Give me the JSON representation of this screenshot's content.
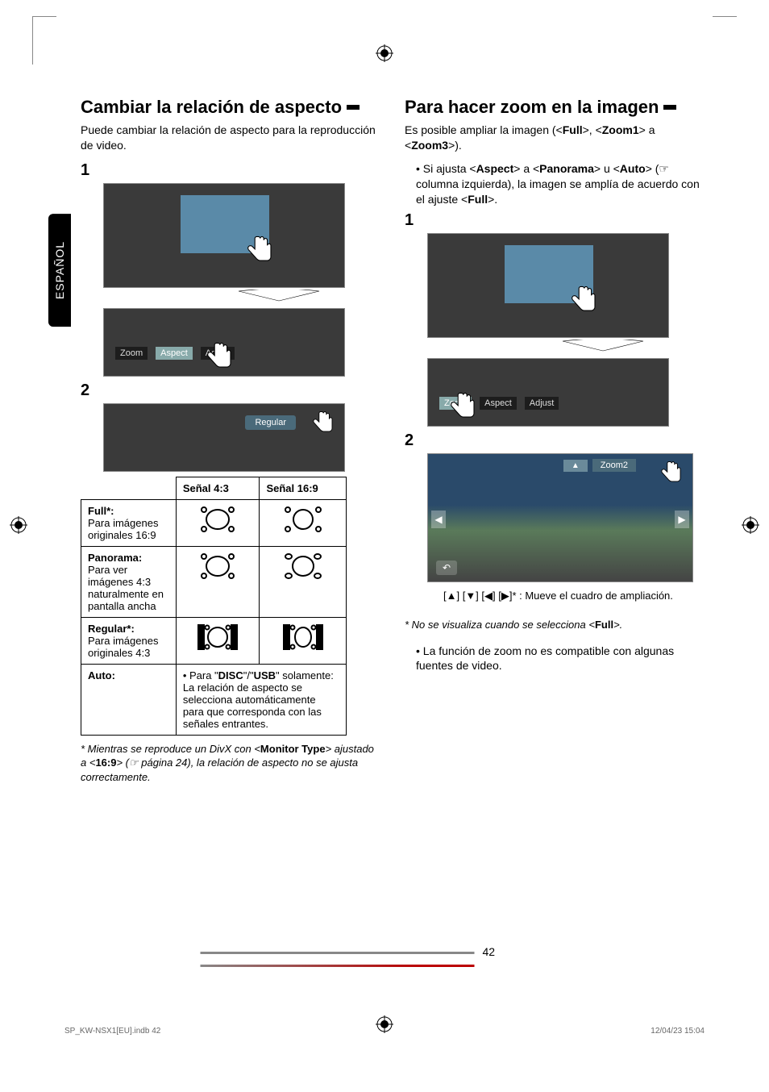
{
  "lang_tab": "ESPAÑOL",
  "page_number": "42",
  "footer_left": "SP_KW-NSX1[EU].indb   42",
  "footer_right": "12/04/23   15:04",
  "left": {
    "heading": "Cambiar la relación de aspecto",
    "intro": "Puede cambiar la relación de aspecto para la reproducción de video.",
    "step1": "1",
    "menu_items": {
      "a": "Zoom",
      "b": "Aspect",
      "c": "Adjust"
    },
    "step2": "2",
    "pill_label": "Regular",
    "table": {
      "col1": "Señal 4:3",
      "col2": "Señal 16:9",
      "row1_label_bold": "Full*:",
      "row1_label_rest": "Para imágenes originales 16:9",
      "row2_label_bold": "Panorama:",
      "row2_label_rest": "Para ver imágenes 4:3 naturalmente en pantalla ancha",
      "row3_label_bold": "Regular*:",
      "row3_label_rest": "Para imágenes originales 4:3",
      "row4_label_bold": "Auto:",
      "row4_text_a": "Para \"",
      "row4_disc": "DISC",
      "row4_slash": "\"/\"",
      "row4_usb": "USB",
      "row4_text_b": "\" solamente: La relación de aspecto se selecciona automáticamente para que corresponda con las señales entrantes."
    },
    "footnote_a": "*  Mientras se reproduce un DivX con <",
    "footnote_mt": "Monitor Type",
    "footnote_b": "> ajustado a <",
    "footnote_169": "16:9",
    "footnote_c": "> (☞ página 24), la relación de aspecto no se ajusta correctamente."
  },
  "right": {
    "heading": "Para hacer zoom en la imagen",
    "intro_a": "Es posible ampliar la imagen (<",
    "intro_full": "Full",
    "intro_b": ">, <",
    "intro_z1": "Zoom1",
    "intro_c": "> a <",
    "intro_z3": "Zoom3",
    "intro_d": ">).",
    "bullet1_a": "Si ajusta <",
    "bullet1_aspect": "Aspect",
    "bullet1_b": "> a <",
    "bullet1_pan": "Panorama",
    "bullet1_c": "> u <",
    "bullet1_auto": "Auto",
    "bullet1_d": "> (☞ columna izquierda), la imagen se amplía de acuerdo con el ajuste <",
    "bullet1_full": "Full",
    "bullet1_e": ">.",
    "step1": "1",
    "menu_items": {
      "a": "Zoom",
      "b": "Aspect",
      "c": "Adjust"
    },
    "step2": "2",
    "zoom_label": "Zoom2",
    "note_arrows": "[▲] [▼] [◀] [▶]* : Mueve el cuadro de ampliación.",
    "ast_note_a": "*  No se visualiza cuando se selecciona <",
    "ast_note_full": "Full",
    "ast_note_b": ">.",
    "bullet2": "La función de zoom no es compatible con algunas fuentes de video."
  }
}
